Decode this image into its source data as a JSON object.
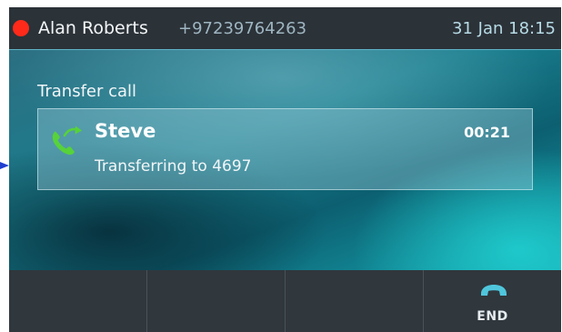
{
  "status_bar": {
    "caller_name": "Alan Roberts",
    "caller_number": "+97239764263",
    "datetime": "31 Jan 18:15",
    "indicator_icon": "red-dot-icon",
    "indicator_color": "#ff2a1a"
  },
  "main": {
    "title": "Transfer call",
    "call": {
      "name": "Steve",
      "duration": "00:21",
      "status": "Transferring to 4697",
      "icon": "phone-transfer-icon",
      "icon_color": "#57d23a"
    }
  },
  "softkeys": [
    {
      "label": ""
    },
    {
      "label": ""
    },
    {
      "label": ""
    },
    {
      "label": "END",
      "icon": "hang-up-icon"
    }
  ]
}
